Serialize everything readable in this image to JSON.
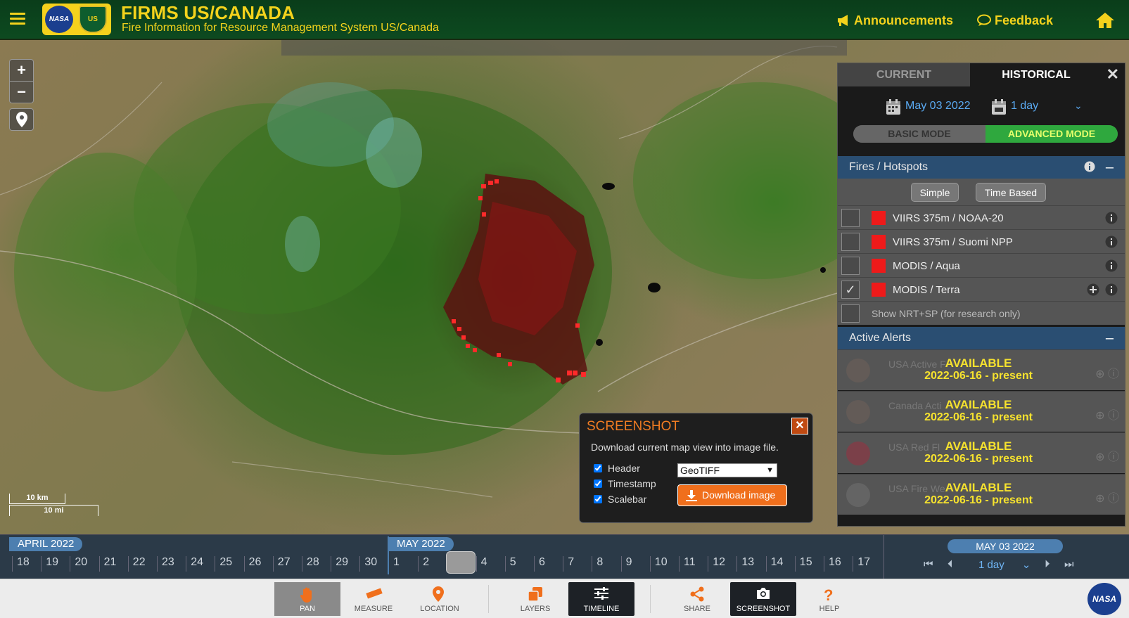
{
  "header": {
    "title": "FIRMS US/CANADA",
    "subtitle": "Fire Information for Resource Management System US/Canada",
    "nasa_logo": "NASA",
    "usfs_logo": "US",
    "announcements": "Announcements",
    "feedback": "Feedback",
    "icons": {
      "menu": "menu-icon",
      "announcements": "megaphone-icon",
      "feedback": "chat-icon",
      "home": "home-icon"
    },
    "accent_color": "#f3d21c",
    "bg_color": "#0d4a20"
  },
  "map": {
    "zoom_in": "+",
    "zoom_out": "−",
    "scale_km": "10 km",
    "scale_mi": "10 mi"
  },
  "panel": {
    "tab_current": "CURRENT",
    "tab_historical": "HISTORICAL",
    "close": "✕",
    "date": "May 03 2022",
    "range": "1 day",
    "basic_mode": "BASIC MODE",
    "advanced_mode": "ADVANCED MODE",
    "fires": {
      "title": "Fires / Hotspots",
      "simple": "Simple",
      "time_based": "Time Based",
      "layers": [
        {
          "name": "VIIRS 375m / NOAA-20",
          "checked": false
        },
        {
          "name": "VIIRS 375m / Suomi NPP",
          "checked": false
        },
        {
          "name": "MODIS / Aqua",
          "checked": false
        },
        {
          "name": "MODIS / Terra",
          "checked": true
        }
      ],
      "nrt_sp": "Show NRT+SP (for research only)"
    },
    "alerts": {
      "title": "Active Alerts",
      "items": [
        {
          "ghost": "USA Active F",
          "status": "AVAILABLE",
          "dates": "2022-06-16 - present"
        },
        {
          "ghost": "Canada Acti",
          "status": "AVAILABLE",
          "dates": "2022-06-16 - present"
        },
        {
          "ghost": "USA Red Fl",
          "status": "AVAILABLE",
          "dates": "2022-06-16 - present"
        },
        {
          "ghost": "USA Fire We",
          "status": "AVAILABLE",
          "dates": "2022-06-16 - present"
        }
      ]
    }
  },
  "screenshot_popup": {
    "title": "SCREENSHOT",
    "close": "✕",
    "description": "Download current map view into image file.",
    "opt_header": "Header",
    "opt_timestamp": "Timestamp",
    "opt_scalebar": "Scalebar",
    "format": "GeoTIFF",
    "download": "Download image",
    "accent_color": "#f06f1c"
  },
  "timeline": {
    "april_label": "APRIL 2022",
    "may_label": "MAY 2022",
    "april_days": [
      "18",
      "19",
      "20",
      "21",
      "22",
      "23",
      "24",
      "25",
      "26",
      "27",
      "28",
      "29",
      "30"
    ],
    "may_days": [
      "1",
      "2",
      "",
      "4",
      "5",
      "6",
      "7",
      "8",
      "9",
      "10",
      "11",
      "12",
      "13",
      "14",
      "15",
      "16",
      "17"
    ],
    "selected_date": "MAY 03 2022",
    "range": "1 day"
  },
  "toolbar": {
    "pan": "PAN",
    "measure": "MEASURE",
    "location": "LOCATION",
    "layers": "LAYERS",
    "timeline": "TIMELINE",
    "share": "SHARE",
    "screenshot": "SCREENSHOT",
    "help": "HELP",
    "nasa": "NASA"
  }
}
